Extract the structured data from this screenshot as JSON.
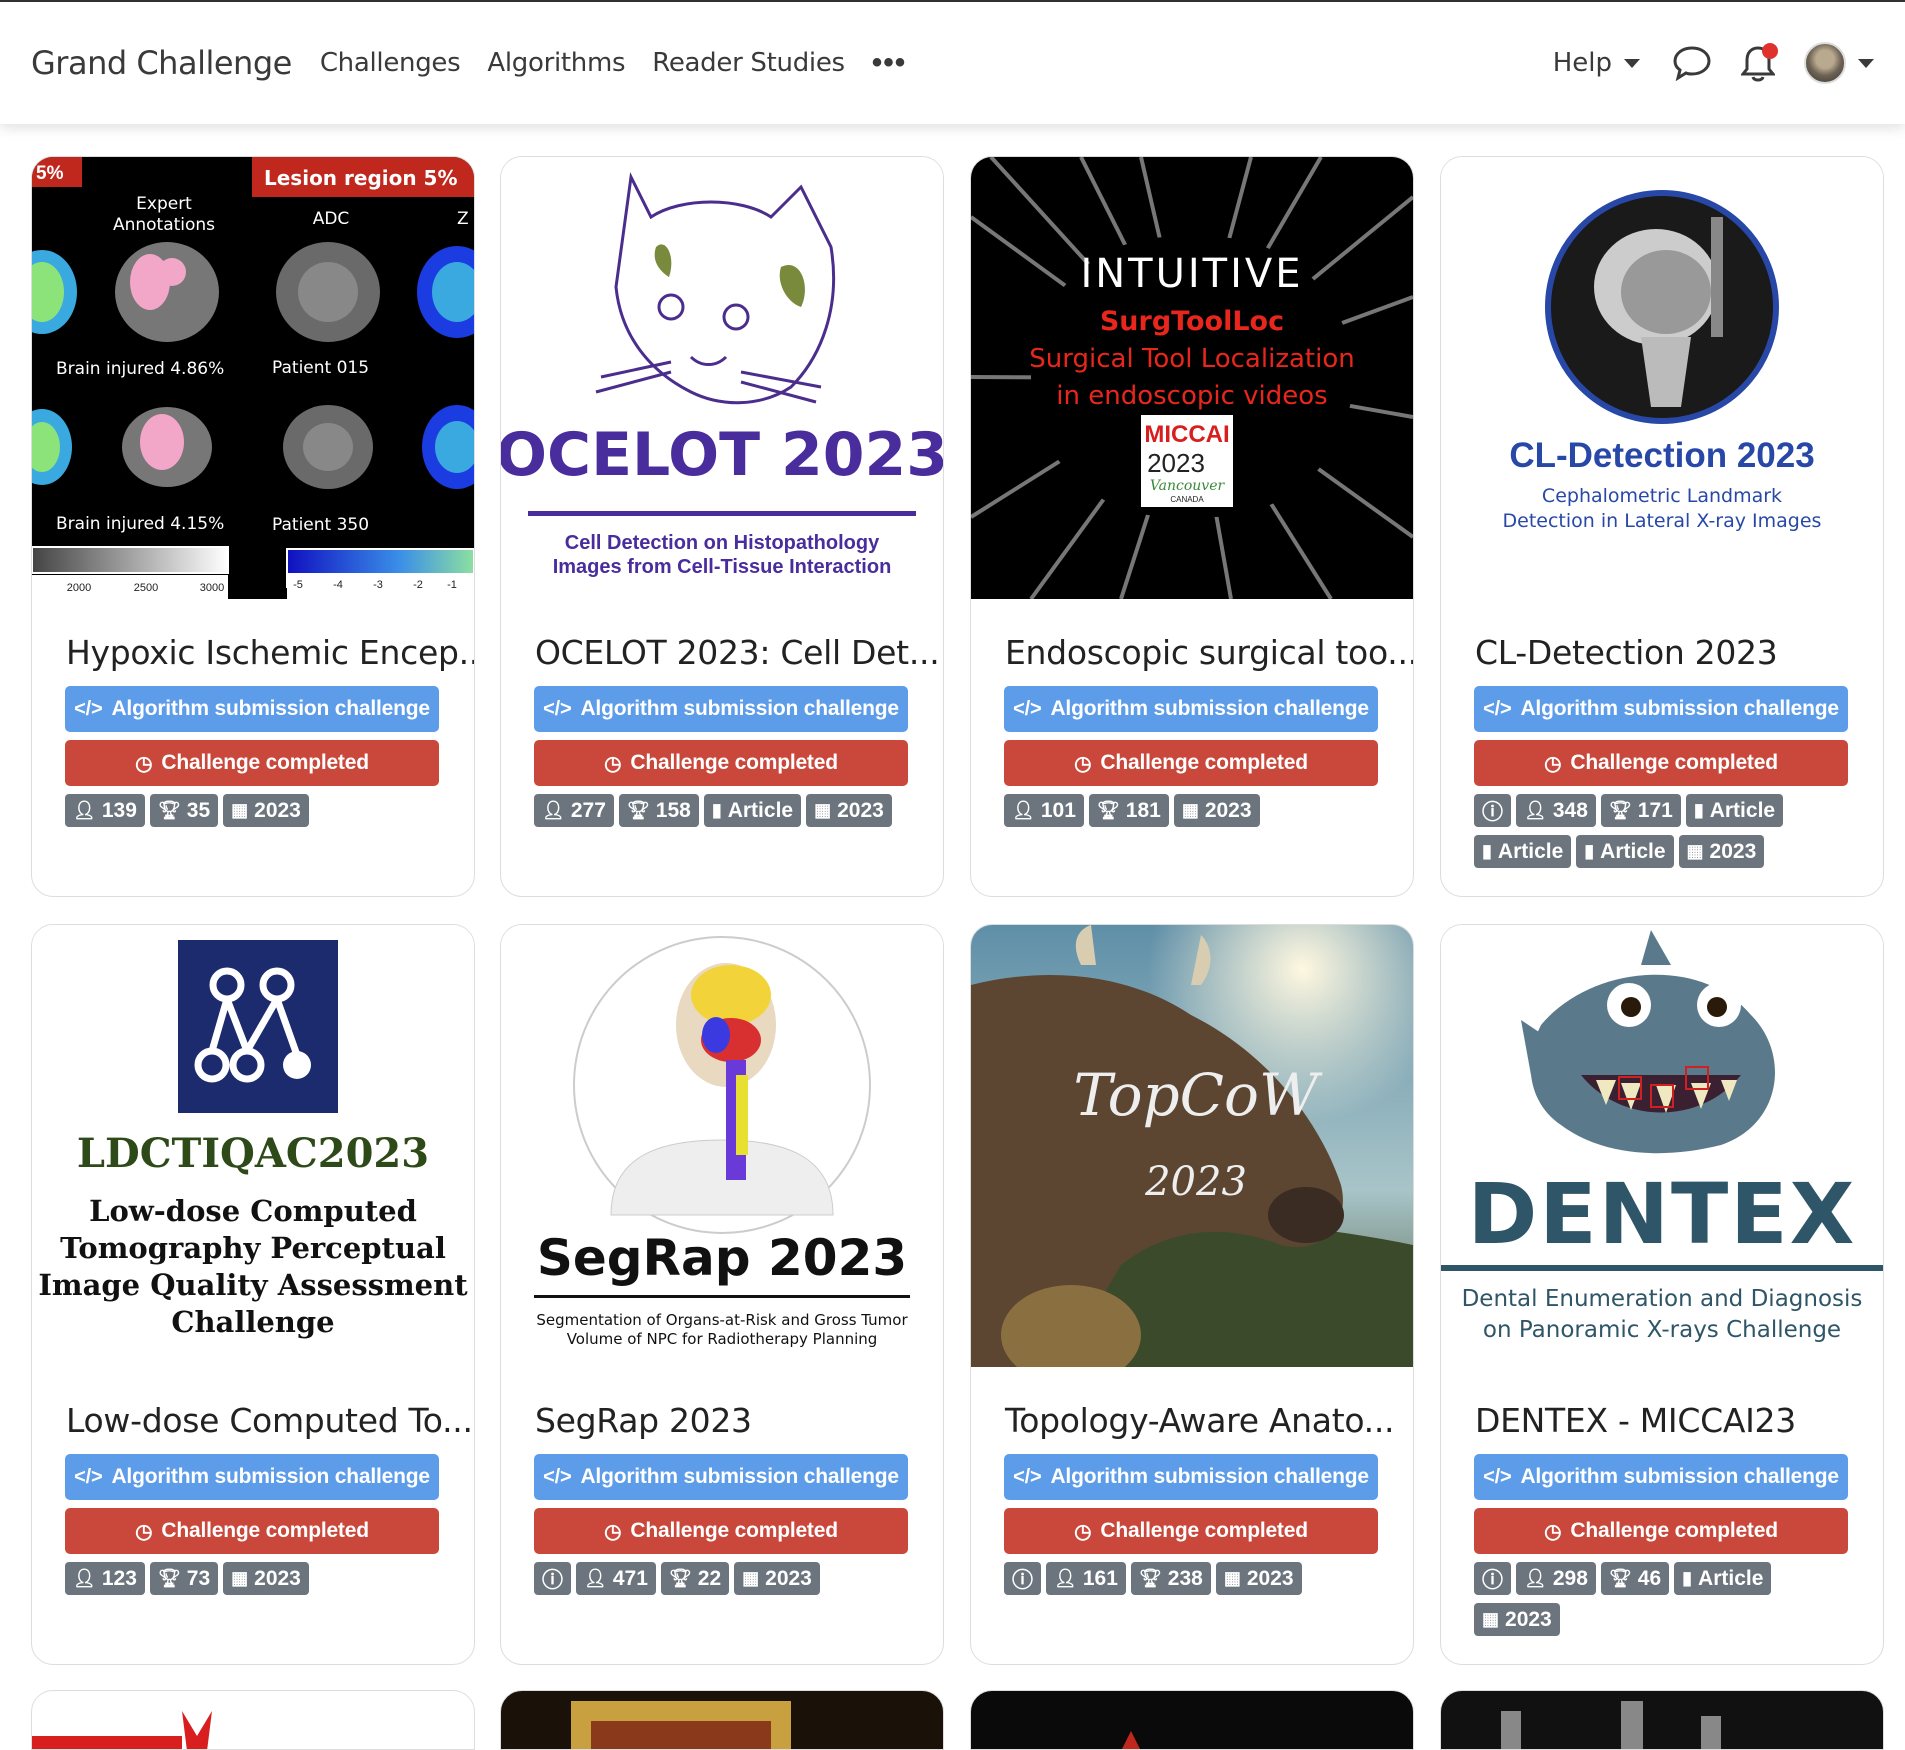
{
  "nav": {
    "brand": "Grand Challenge",
    "links": [
      "Challenges",
      "Algorithms",
      "Reader Studies"
    ],
    "more": "•••",
    "help": "Help"
  },
  "labels": {
    "algorithm": "Algorithm submission challenge",
    "completed": "Challenge completed"
  },
  "cards": [
    {
      "title": "Hypoxic Ischemic Encep...",
      "participants": "139",
      "submissions": "35",
      "year": "2023",
      "thumb": {
        "badge_left": "5%",
        "badge_right": "Lesion region  5%",
        "col1": "Expert Annotations",
        "col2": "ADC",
        "col3": "Z",
        "row1a": "Brain injured 4.86%",
        "row1b": "Patient 015",
        "row2a": "Brain injured 4.15%",
        "row2b": "Patient 350",
        "ticks1": [
          "2000",
          "2500",
          "3000"
        ],
        "ticks2": [
          "-5",
          "-4",
          "-3",
          "-2",
          "-1"
        ]
      }
    },
    {
      "title": "OCELOT 2023: Cell Det...",
      "participants": "277",
      "submissions": "158",
      "article": "Article",
      "year": "2023",
      "thumb": {
        "heading": "OCELOT 2023",
        "line1": "Cell Detection on Histopathology",
        "line2": "Images from Cell-Tissue Interaction"
      }
    },
    {
      "title": "Endoscopic surgical too...",
      "participants": "101",
      "submissions": "181",
      "year": "2023",
      "thumb": {
        "brand": "INTUITIVE",
        "name": "SurgToolLoc",
        "line1": "Surgical Tool Localization",
        "line2": "in endoscopic videos",
        "miccai": "MICCAI",
        "yr": "2023",
        "city": "Vancouver",
        "country": "CANADA"
      }
    },
    {
      "title": "CL-Detection 2023",
      "participants": "348",
      "submissions": "171",
      "articles": [
        "Article",
        "Article",
        "Article"
      ],
      "year": "2023",
      "thumb": {
        "heading": "CL-Detection 2023",
        "line1": "Cephalometric Landmark",
        "line2": "Detection in Lateral X-ray Images"
      }
    },
    {
      "title": "Low-dose Computed To...",
      "participants": "123",
      "submissions": "73",
      "year": "2023",
      "thumb": {
        "heading": "LDCTIQAC2023",
        "lines": [
          "Low-dose Computed",
          "Tomography Perceptual",
          "Image Quality Assessment",
          "Challenge"
        ]
      }
    },
    {
      "title": "SegRap 2023",
      "participants": "471",
      "submissions": "22",
      "year": "2023",
      "thumb": {
        "heading": "SegRap 2023",
        "line1": "Segmentation of Organs-at-Risk and Gross Tumor",
        "line2": "Volume of NPC for Radiotherapy Planning"
      }
    },
    {
      "title": "Topology-Aware Anato...",
      "participants": "161",
      "submissions": "238",
      "year": "2023",
      "thumb": {
        "name": "TopCoW",
        "yr": "2023"
      }
    },
    {
      "title": "DENTEX - MICCAI23",
      "participants": "298",
      "submissions": "46",
      "article": "Article",
      "year": "2023",
      "thumb": {
        "heading": "DENTEX",
        "line1": "Dental Enumeration and Diagnosis",
        "line2": "on Panoramic X-rays Challenge"
      }
    }
  ],
  "colors": {
    "blue": "#5c9ce8",
    "red": "#c9483b",
    "badge": "#6c757d",
    "ocelot": "#4a2d9c",
    "cl": "#2848a8",
    "dentex": "#2f5668"
  }
}
